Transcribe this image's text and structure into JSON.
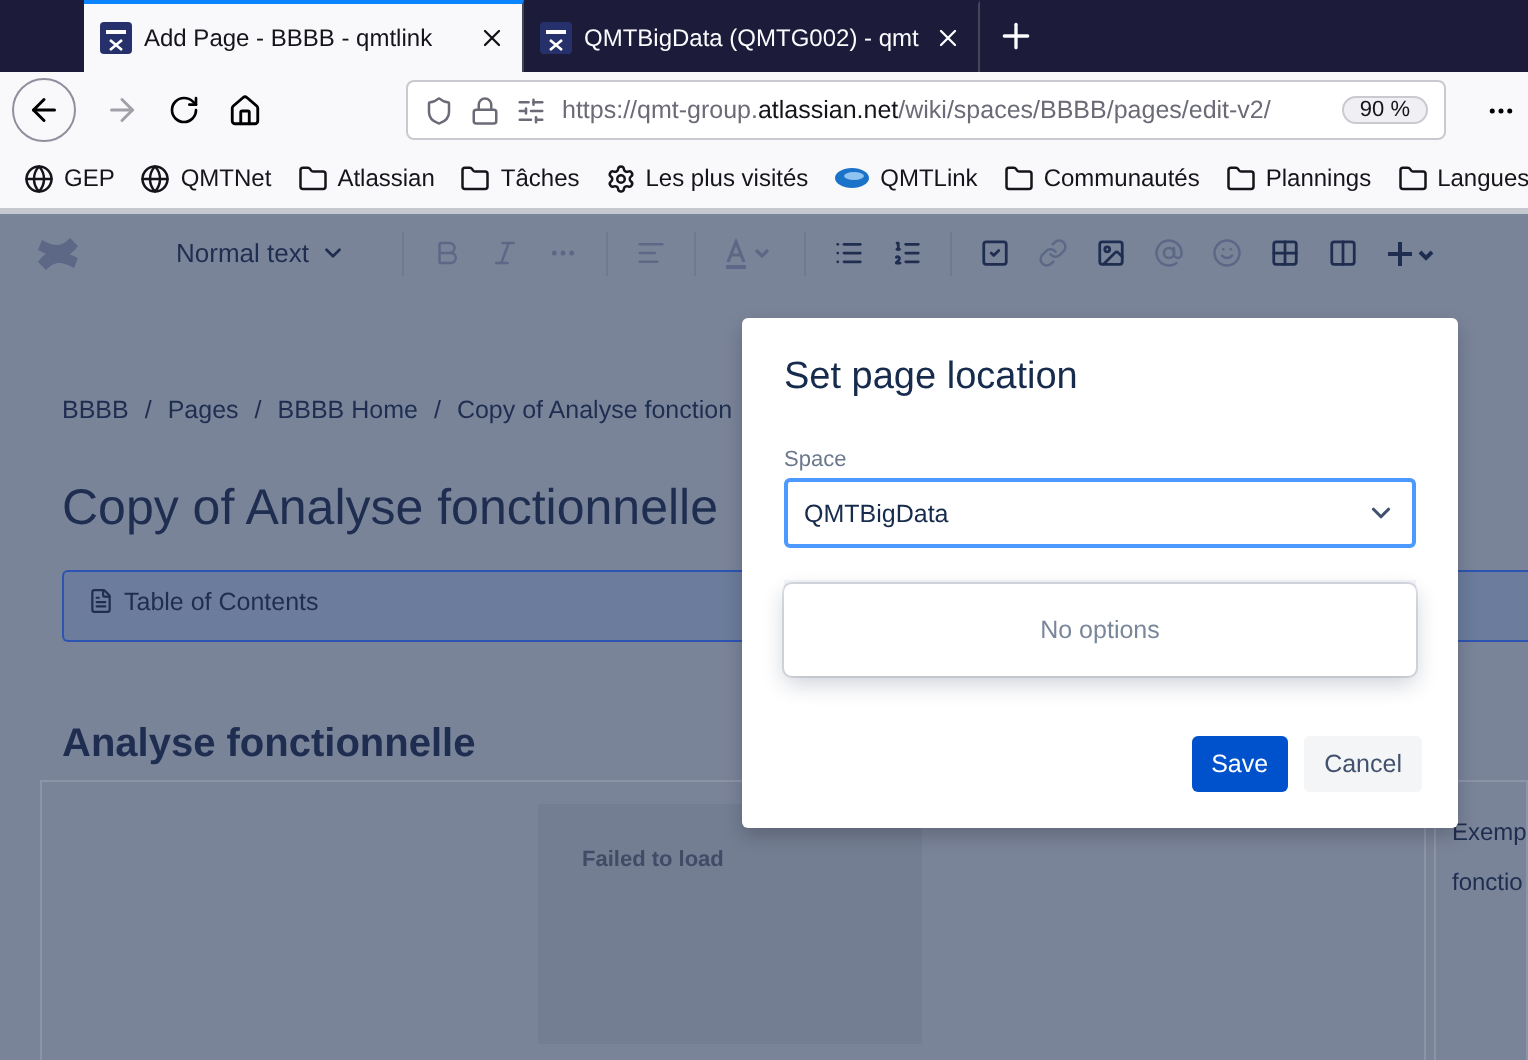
{
  "browser": {
    "tabs": [
      {
        "title": "Add Page - BBBB - qmtlink",
        "selected": true
      },
      {
        "title": "QMTBigData (QMTG002) - qmt",
        "selected": false
      }
    ],
    "url": {
      "prefix": "https://qmt-group.",
      "domain": "atlassian.net",
      "path": "/wiki/spaces/BBBB/pages/edit-v2/"
    },
    "zoom": "90 %",
    "bookmarks": [
      {
        "kind": "globe",
        "label": "GEP"
      },
      {
        "kind": "globe",
        "label": "QMTNet"
      },
      {
        "kind": "folder",
        "label": "Atlassian"
      },
      {
        "kind": "folder",
        "label": "Tâches"
      },
      {
        "kind": "gear",
        "label": "Les plus visités"
      },
      {
        "kind": "logo",
        "label": "QMTLink"
      },
      {
        "kind": "folder",
        "label": "Communautés"
      },
      {
        "kind": "folder",
        "label": "Plannings"
      },
      {
        "kind": "folder",
        "label": "Langues"
      }
    ]
  },
  "editor": {
    "text_style": "Normal text",
    "breadcrumbs": {
      "separator": "/",
      "items": [
        "BBBB",
        "Pages",
        "BBBB Home",
        "Copy of Analyse fonction"
      ]
    },
    "title": "Copy of Analyse fonctionnelle",
    "toc": "Table of Contents",
    "heading": "Analyse fonctionnelle",
    "image_error": "Failed to load",
    "side_text": [
      "Exemp",
      "fonctio"
    ]
  },
  "dialog": {
    "title": "Set page location",
    "field": {
      "label": "Space",
      "value": "QMTBigData"
    },
    "menu": {
      "empty": "No options"
    },
    "buttons": [
      {
        "label": "Save",
        "kind": "primary"
      },
      {
        "label": "Cancel",
        "kind": "secondary"
      }
    ]
  }
}
